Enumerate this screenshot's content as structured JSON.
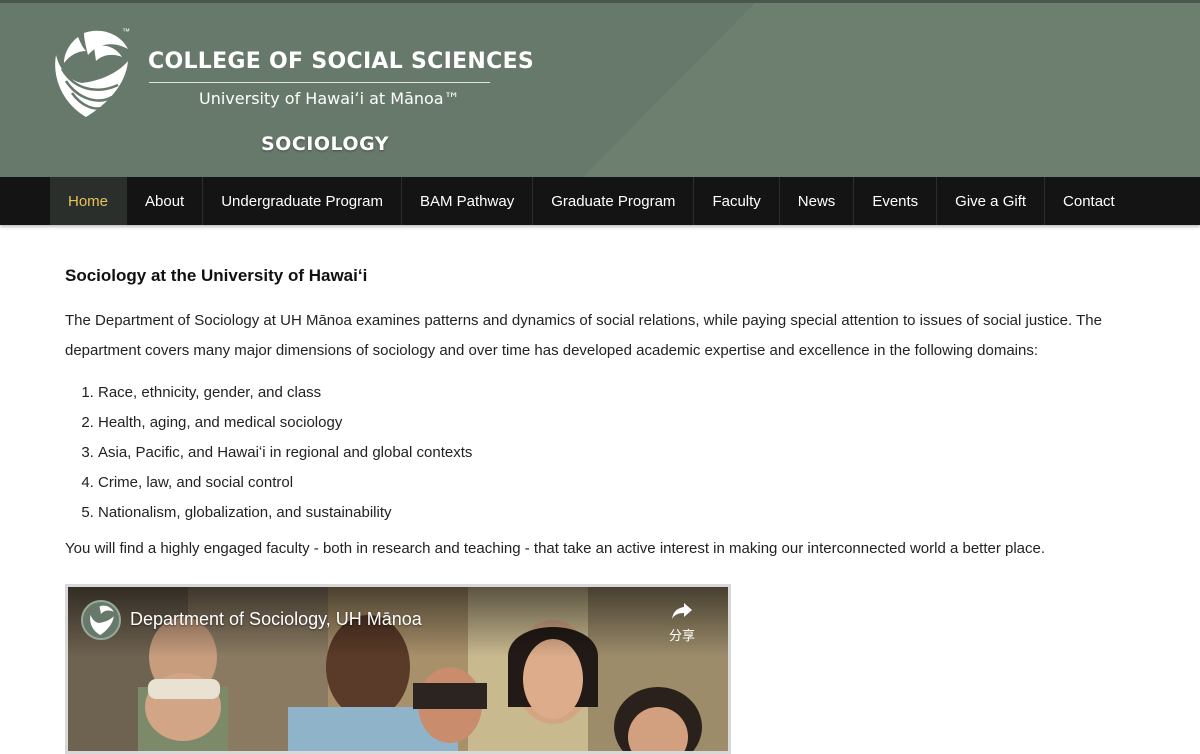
{
  "header": {
    "college_title": "COLLEGE OF SOCIAL SCIENCES",
    "college_subtitle": "University of Hawaiʻi at Mānoa™",
    "department": "SOCIOLOGY",
    "trademark": "™",
    "colors": {
      "band": "#66796a",
      "band_light": "#6d8070"
    }
  },
  "nav": {
    "items": [
      {
        "label": "Home",
        "active": true
      },
      {
        "label": "About"
      },
      {
        "label": "Undergraduate Program"
      },
      {
        "label": "BAM Pathway"
      },
      {
        "label": "Graduate Program"
      },
      {
        "label": "Faculty"
      },
      {
        "label": "News"
      },
      {
        "label": "Events"
      },
      {
        "label": "Give a Gift"
      },
      {
        "label": "Contact"
      }
    ],
    "active_color": "#e8c15a"
  },
  "main": {
    "heading": "Sociology at the University of Hawaiʻi",
    "intro": "The Department of Sociology at UH Mānoa examines patterns and dynamics of social relations, while paying special attention to issues of social justice. The department covers many major dimensions of sociology and over time has developed academic expertise and excellence in the following domains:",
    "domains": [
      "Race, ethnicity, gender, and class",
      "Health, aging, and medical sociology",
      "Asia, Pacific, and Hawaiʻi in regional and global contexts",
      "Crime, law, and social control",
      "Nationalism, globalization, and sustainability"
    ],
    "closing": "You will find a highly engaged faculty - both in research and teaching - that take an active interest in making our interconnected world a better place."
  },
  "video": {
    "title": "Department of Sociology, UH Mānoa",
    "share_label": "分享",
    "share_icon": "share-arrow-icon"
  }
}
